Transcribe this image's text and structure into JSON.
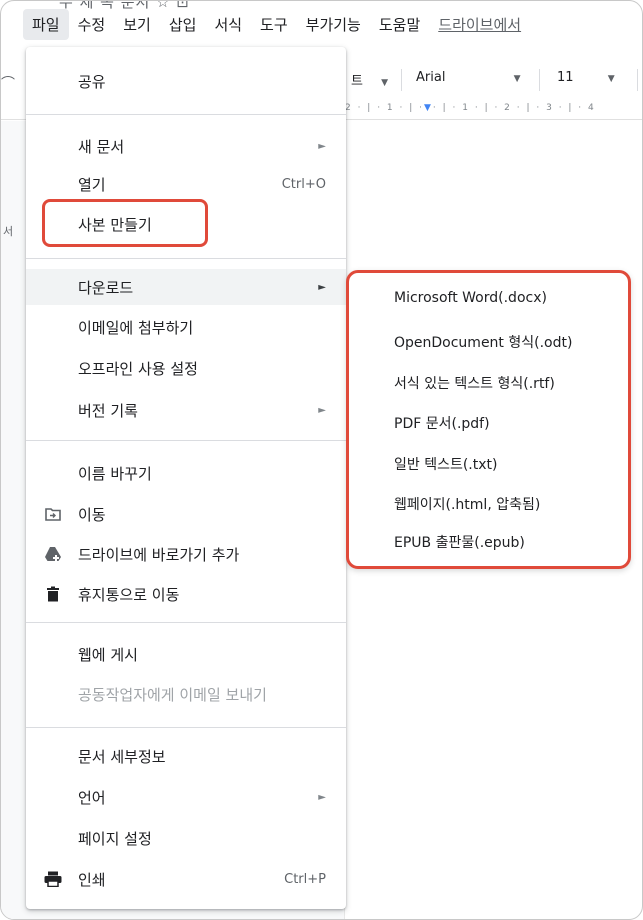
{
  "menubar": {
    "cut_title": "무 제 목   문서   ☆   ⊡",
    "items": [
      "파일",
      "수정",
      "보기",
      "삽입",
      "서식",
      "도구",
      "부가기능",
      "도움말"
    ],
    "drive_text": "드라이브에서"
  },
  "toolbar": {
    "left_edge": "⌒",
    "style_cut": "트",
    "font": "Arial",
    "size": "11"
  },
  "ruler": {
    "text_a": "2 · | · 1 · | ·",
    "marker": "▼",
    "text_b": "· | · 1 · | · 2 · | · 3 · | · 4"
  },
  "doc": {
    "side_char": "서"
  },
  "file_menu": {
    "share": "공유",
    "new_doc": "새 문서",
    "open": "열기",
    "open_shortcut": "Ctrl+O",
    "make_copy": "사본 만들기",
    "download": "다운로드",
    "email_attach": "이메일에 첨부하기",
    "offline": "오프라인 사용 설정",
    "version_history": "버전 기록",
    "rename": "이름 바꾸기",
    "move": "이동",
    "add_shortcut": "드라이브에 바로가기 추가",
    "trash": "휴지통으로 이동",
    "publish_web": "웹에 게시",
    "email_collab": "공동작업자에게 이메일 보내기",
    "doc_details": "문서 세부정보",
    "language": "언어",
    "page_setup": "페이지 설정",
    "print": "인쇄",
    "print_shortcut": "Ctrl+P",
    "arrow": "►"
  },
  "download_menu": {
    "items": [
      "Microsoft Word(.docx)",
      "OpenDocument 형식(.odt)",
      "서식 있는 텍스트 형식(.rtf)",
      "PDF 문서(.pdf)",
      "일반 텍스트(.txt)",
      "웹페이지(.html, 압축됨)",
      "EPUB 출판물(.epub)"
    ]
  },
  "colors": {
    "highlight": "#e04a3a",
    "hover_bg": "#f1f3f4",
    "ruler_marker": "#4285f4"
  }
}
